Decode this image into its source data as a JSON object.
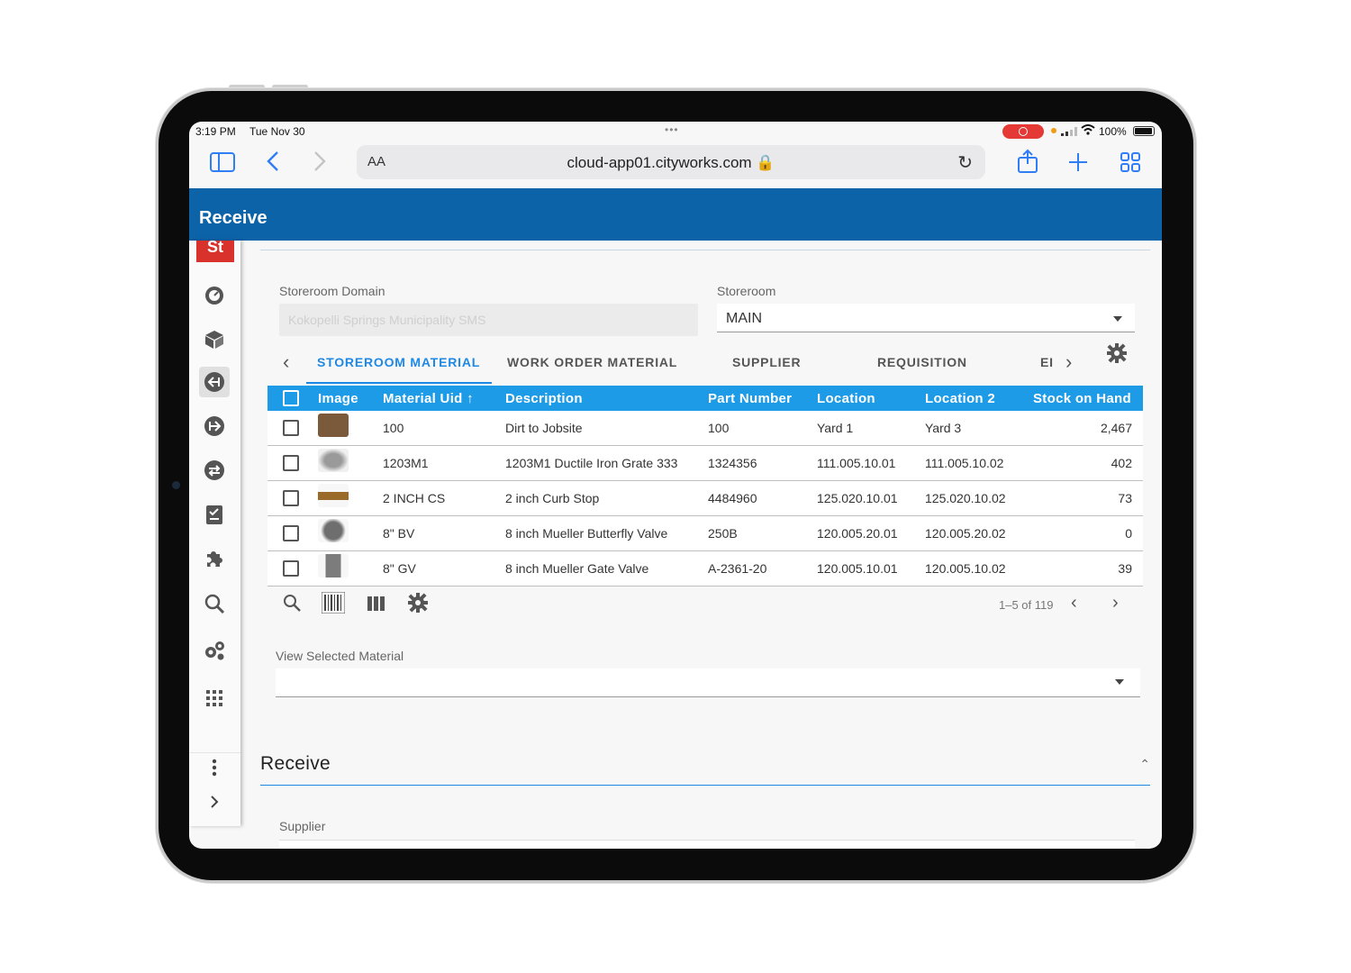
{
  "status_bar": {
    "time": "3:19 PM",
    "date": "Tue Nov 30",
    "battery": "100%"
  },
  "browser": {
    "aa_label": "AA",
    "url": "cloud-app01.cityworks.com 🔒"
  },
  "app": {
    "title": "Receive",
    "logo_text": "St"
  },
  "form": {
    "storeroom_domain_label": "Storeroom Domain",
    "storeroom_domain_value": "Kokopelli Springs Municipality SMS",
    "storeroom_label": "Storeroom",
    "storeroom_value": "MAIN"
  },
  "tabs": [
    "STOREROOM MATERIAL",
    "WORK ORDER MATERIAL",
    "SUPPLIER",
    "REQUISITION",
    "EI"
  ],
  "table": {
    "columns": [
      "Image",
      "Material Uid",
      "Description",
      "Part Number",
      "Location",
      "Location 2",
      "Stock on Hand"
    ],
    "sort_indicator": "↑",
    "rows": [
      {
        "uid": "100",
        "description": "Dirt to Jobsite",
        "part": "100",
        "location": "Yard 1",
        "location2": "Yard 3",
        "stock": "2,467",
        "thumb": "#7a5a3a"
      },
      {
        "uid": "1203M1",
        "description": "1203M1 Ductile Iron Grate 333",
        "part": "1324356",
        "location": "111.005.10.01",
        "location2": "111.005.10.02",
        "stock": "402",
        "thumb": "#8c8c8c"
      },
      {
        "uid": "2 INCH CS",
        "description": "2 inch Curb Stop",
        "part": "4484960",
        "location": "125.020.10.01",
        "location2": "125.020.10.02",
        "stock": "73",
        "thumb": "#9a6a2a"
      },
      {
        "uid": "8\" BV",
        "description": "8 inch Mueller Butterfly Valve",
        "part": "250B",
        "location": "120.005.20.01",
        "location2": "120.005.20.02",
        "stock": "0",
        "thumb": "#6e6e6e"
      },
      {
        "uid": "8\" GV",
        "description": "8 inch Mueller Gate Valve",
        "part": "A-2361-20",
        "location": "120.005.10.01",
        "location2": "120.005.10.02",
        "stock": "39",
        "thumb": "#7c7c7c"
      }
    ],
    "pager": "1–5 of 119"
  },
  "view_selected": {
    "label": "View Selected Material",
    "value": ""
  },
  "receive_section": {
    "title": "Receive",
    "supplier_label": "Supplier"
  },
  "colors": {
    "header": "#0d63a8",
    "table_header": "#1e9be6",
    "accent": "#1e88e5",
    "logo": "#d9312b"
  },
  "icons": [
    "sidebar-icon",
    "back-icon",
    "forward-icon",
    "reload-icon",
    "share-icon",
    "plus-icon",
    "tabs-icon",
    "dashboard-icon",
    "box-icon",
    "receive-icon",
    "issue-icon",
    "transfer-icon",
    "checklist-icon",
    "puzzle-icon",
    "search-icon",
    "gears-icon",
    "grid-icon",
    "more-vert-icon",
    "chevron-right-icon",
    "barcode-icon",
    "columns-icon",
    "gear-icon"
  ]
}
